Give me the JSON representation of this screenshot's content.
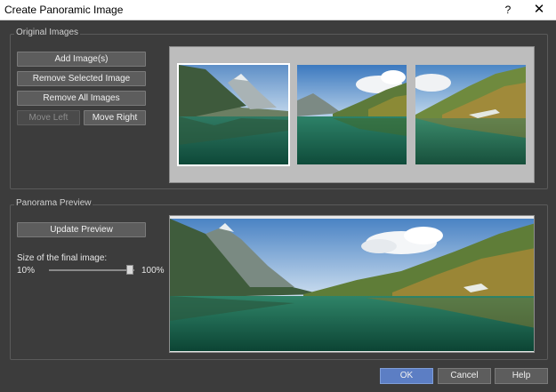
{
  "window": {
    "title": "Create Panoramic Image",
    "help_glyph": "?",
    "close_glyph": "✕"
  },
  "original_images": {
    "group_label": "Original Images",
    "buttons": {
      "add": "Add Image(s)",
      "remove_selected": "Remove Selected Image",
      "remove_all": "Remove All Images",
      "move_left": "Move Left",
      "move_right": "Move Right"
    },
    "thumbnails": [
      {
        "id": 1,
        "selected": true
      },
      {
        "id": 2,
        "selected": false
      },
      {
        "id": 3,
        "selected": false
      }
    ]
  },
  "panorama_preview": {
    "group_label": "Panorama Preview",
    "update_button": "Update Preview",
    "size_label": "Size of the final image:",
    "size_min": "10%",
    "size_max": "100%",
    "size_value_fraction": 0.95
  },
  "footer": {
    "ok": "OK",
    "cancel": "Cancel",
    "help": "Help"
  },
  "colors": {
    "background": "#3c3c3c",
    "ok_button": "#5c7ec4"
  }
}
